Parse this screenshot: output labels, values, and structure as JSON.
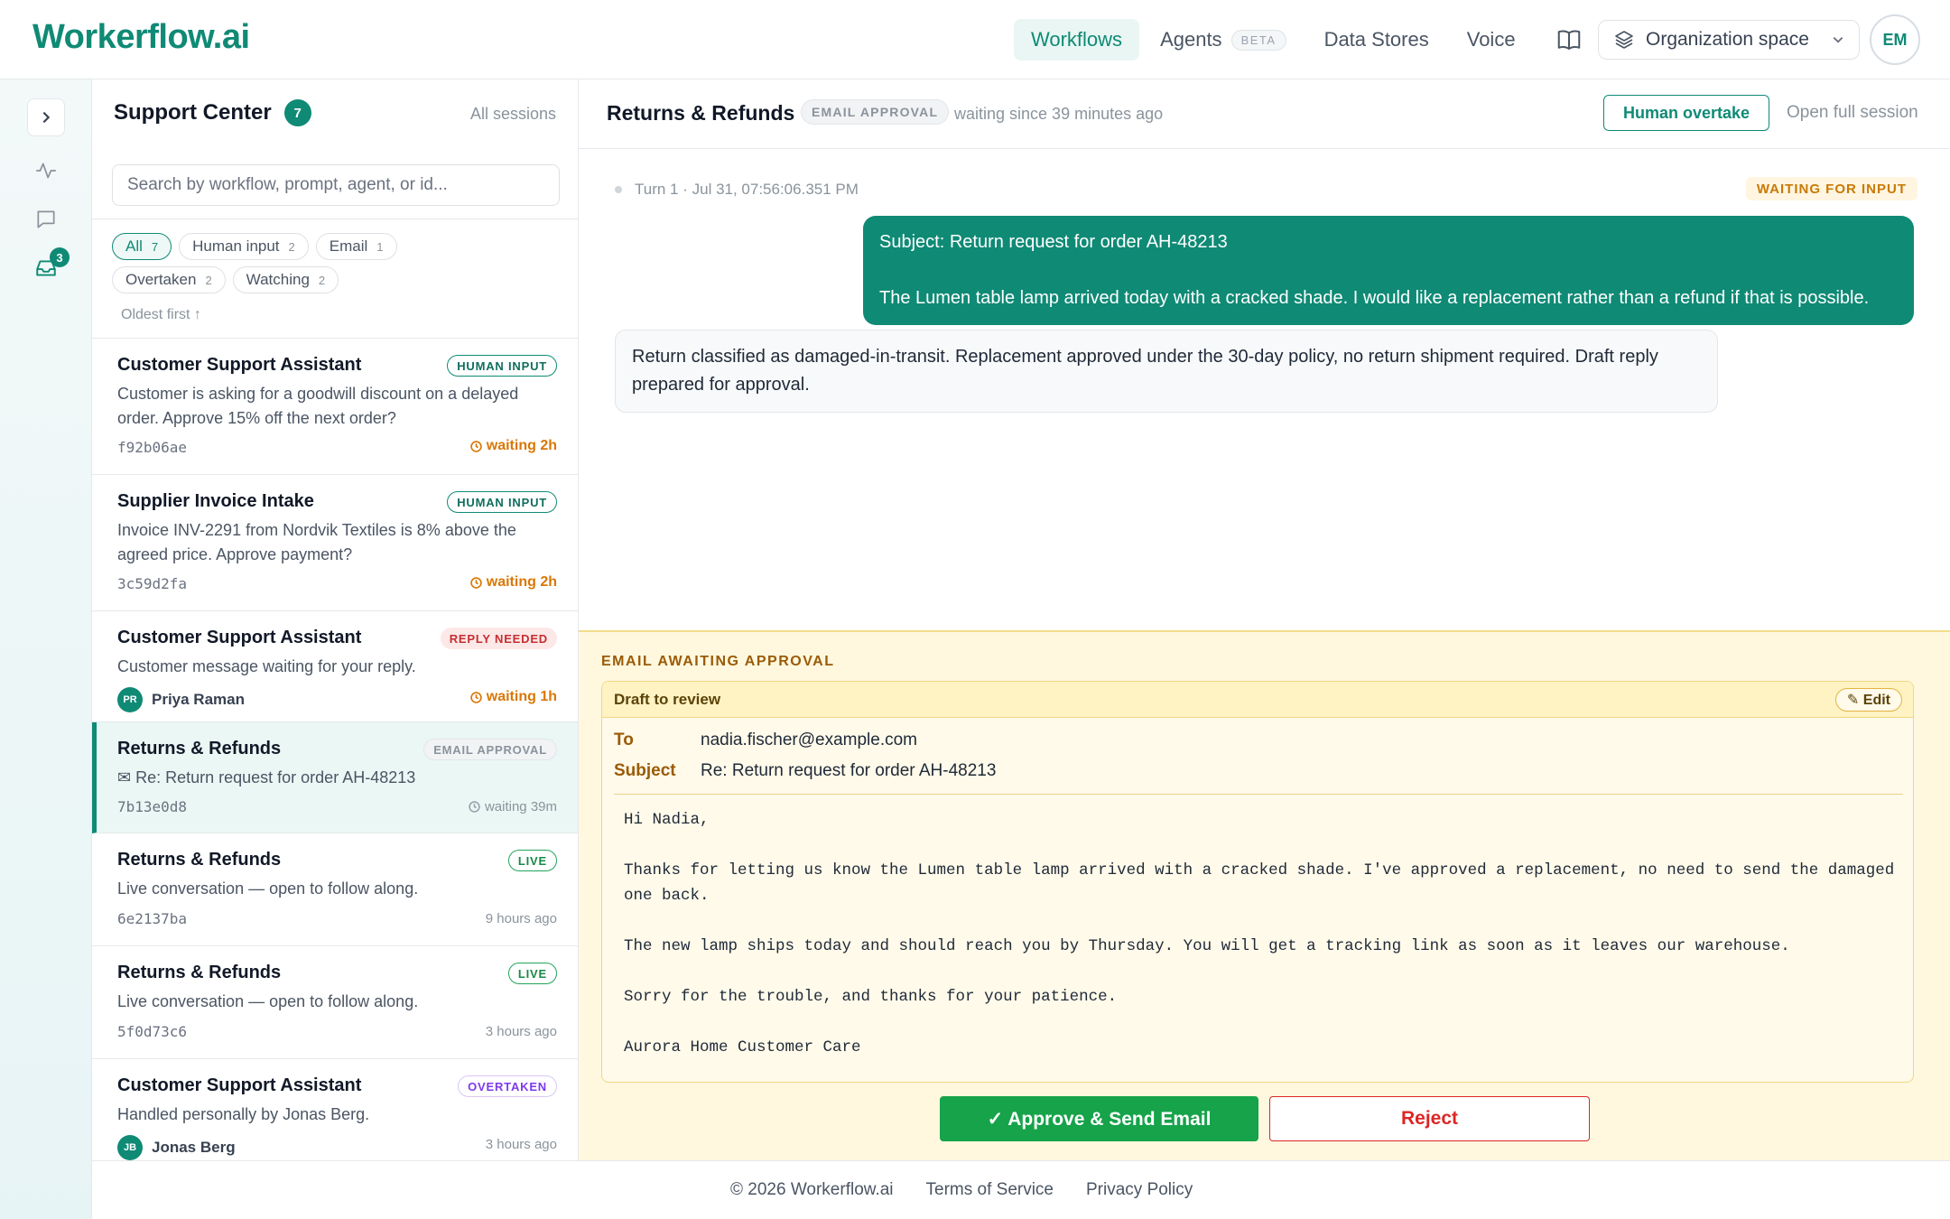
{
  "app": {
    "logo": "Workerflow.ai",
    "accent_color": "#0f8a75"
  },
  "nav": {
    "items": [
      {
        "label": "Workflows",
        "active": true
      },
      {
        "label": "Agents",
        "badge": "BETA"
      },
      {
        "label": "Data Stores"
      },
      {
        "label": "Voice"
      }
    ],
    "docs_icon": "book-icon",
    "org_selector": "Organization space",
    "user_initials": "EM"
  },
  "rail": {
    "inbox_count": "3"
  },
  "sessions_panel": {
    "title": "Support Center",
    "count": "7",
    "all_sessions": "All sessions",
    "search_placeholder": "Search by workflow, prompt, agent, or id...",
    "filters": [
      {
        "label": "All",
        "count": "7",
        "active": true
      },
      {
        "label": "Human input",
        "count": "2"
      },
      {
        "label": "Email",
        "count": "1"
      },
      {
        "label": "Overtaken",
        "count": "2"
      },
      {
        "label": "Watching",
        "count": "2"
      }
    ],
    "sort": "Oldest first ↑",
    "sessions": [
      {
        "title": "Customer Support Assistant",
        "badge": "HUMAN INPUT",
        "desc": "Customer is asking for a goodwill discount on a delayed order. Approve 15% off the next order?",
        "id": "f92b06ae",
        "meta": "waiting 2h"
      },
      {
        "title": "Supplier Invoice Intake",
        "badge": "HUMAN INPUT",
        "desc": "Invoice INV-2291 from Nordvik Textiles is 8% above the agreed price. Approve payment?",
        "id": "3c59d2fa",
        "meta": "waiting 2h"
      },
      {
        "title": "Customer Support Assistant",
        "badge": "REPLY NEEDED",
        "desc": "Customer message waiting for your reply.",
        "user_initials": "PR",
        "user_name": "Priya Raman",
        "meta": "waiting 1h"
      },
      {
        "title": "Returns & Refunds",
        "badge": "EMAIL APPROVAL",
        "desc": "✉ Re: Return request for order AH-48213",
        "id": "7b13e0d8",
        "meta": "waiting 39m"
      },
      {
        "title": "Returns & Refunds",
        "badge": "LIVE",
        "desc": "Live conversation — open to follow along.",
        "id": "6e2137ba",
        "meta": "9 hours ago"
      },
      {
        "title": "Returns & Refunds",
        "badge": "LIVE",
        "desc": "Live conversation — open to follow along.",
        "id": "5f0d73c6",
        "meta": "3 hours ago"
      },
      {
        "title": "Customer Support Assistant",
        "badge": "OVERTAKEN",
        "desc": "Handled personally by Jonas Berg.",
        "user_initials": "JB",
        "user_name": "Jonas Berg",
        "meta": "3 hours ago"
      }
    ]
  },
  "conversation": {
    "title": "Returns & Refunds",
    "badge": "EMAIL APPROVAL",
    "waiting_text": "waiting since 39 minutes ago",
    "overtake_button": "Human overtake",
    "open_full": "Open full session",
    "turn_meta": "Turn 1 · Jul 31, 07:56:06.351 PM",
    "turn_status": "WAITING FOR INPUT",
    "user_message_subject": "Subject: Return request for order AH-48213",
    "user_message_body": "The Lumen table lamp arrived today with a cracked shade. I would like a replacement rather than a refund if that is possible.",
    "agent_message": "Return classified as damaged-in-transit. Replacement approved under the 30-day policy, no return shipment required. Draft reply prepared for approval."
  },
  "approval": {
    "section_title": "EMAIL AWAITING APPROVAL",
    "draft_label": "Draft to review",
    "edit_button": "✎ Edit",
    "to_label": "To",
    "to_value": "nadia.fischer@example.com",
    "subject_label": "Subject",
    "subject_value": "Re: Return request for order AH-48213",
    "body": [
      "Hi Nadia,",
      "Thanks for letting us know the Lumen table lamp arrived with a cracked shade. I've approved a replacement, no need to send the damaged one back.",
      "The new lamp ships today and should reach you by Thursday. You will get a tracking link as soon as it leaves our warehouse.",
      "Sorry for the trouble, and thanks for your patience.",
      "Aurora Home Customer Care"
    ],
    "approve_button": "✓ Approve & Send Email",
    "reject_button": "Reject"
  },
  "footer": {
    "copyright": "© 2026 Workerflow.ai",
    "terms": "Terms of Service",
    "privacy": "Privacy Policy"
  }
}
